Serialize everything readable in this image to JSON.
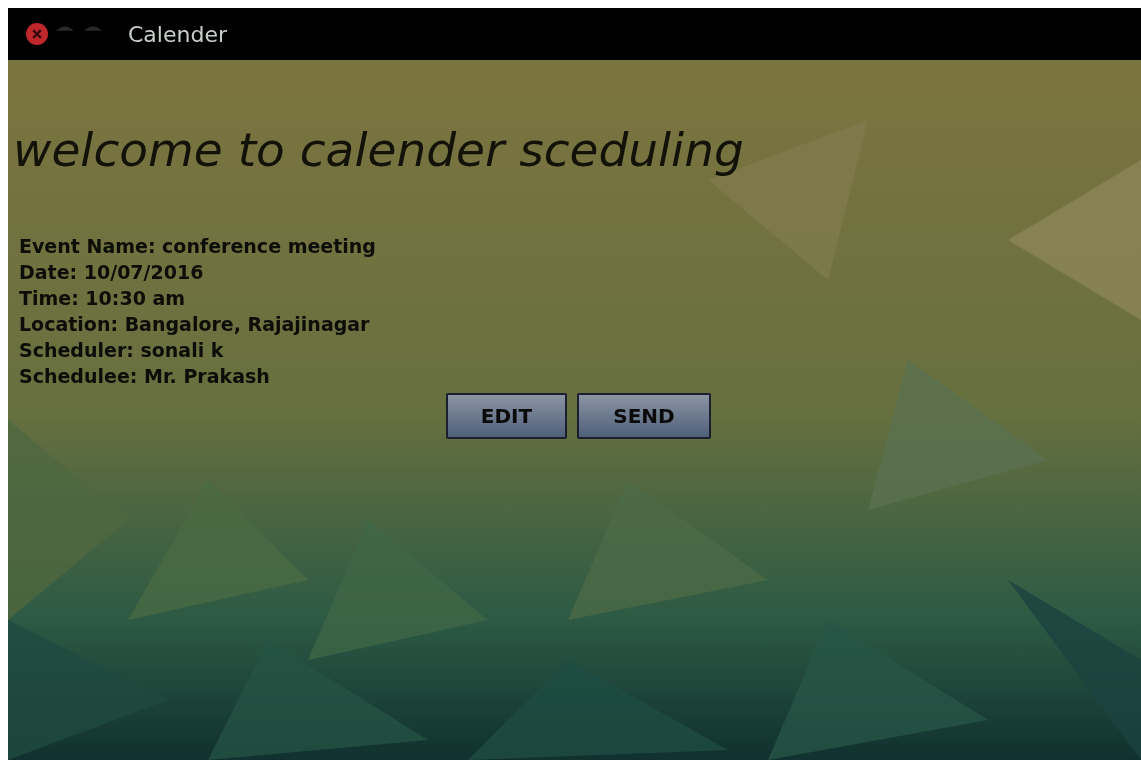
{
  "window": {
    "title": "Calender"
  },
  "heading": "welcome to calender sceduling",
  "details": [
    "Event Name: conference meeting",
    "Date: 10/07/2016",
    "Time: 10:30 am",
    "Location: Bangalore, Rajajinagar",
    "Scheduler: sonali k",
    "Schedulee: Mr. Prakash"
  ],
  "buttons": [
    "EDIT",
    "SEND"
  ]
}
